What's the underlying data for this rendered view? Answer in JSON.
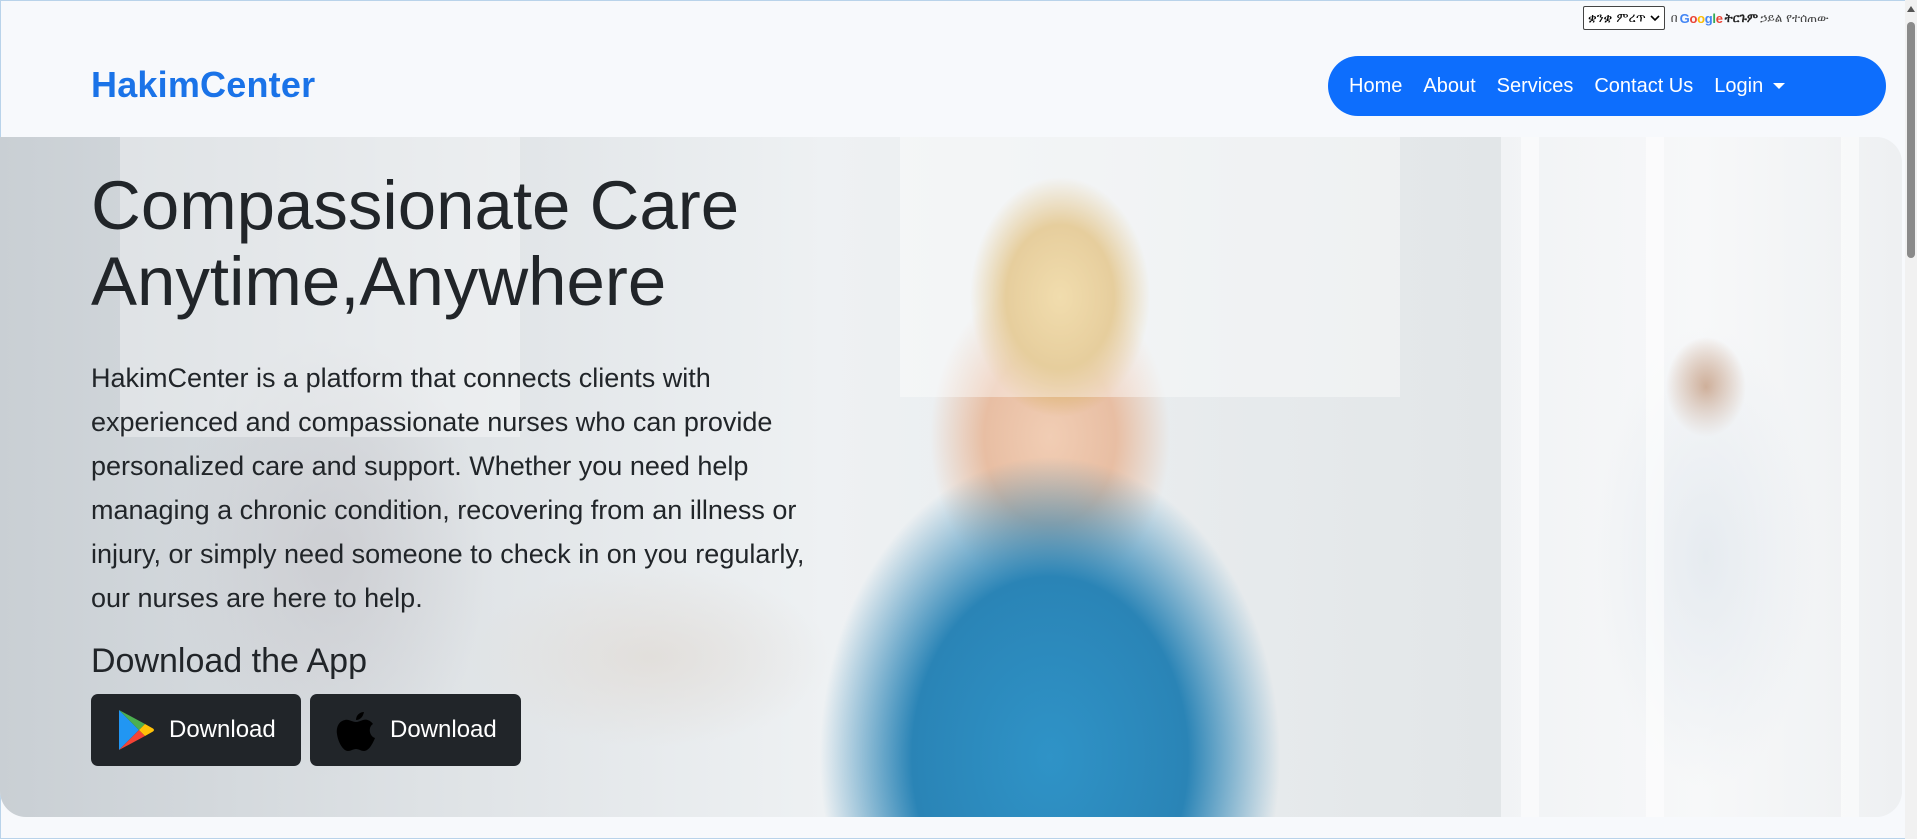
{
  "translate": {
    "language_select": "ቋንቋ ምረጥ",
    "powered_prefix": "በ",
    "google_letters": [
      "G",
      "o",
      "o",
      "g",
      "l",
      "e"
    ],
    "translate_word": "ትርጉም",
    "powered_suffix": "ኃይል የተሰጠው"
  },
  "header": {
    "brand": "HakimCenter",
    "nav": {
      "home": "Home",
      "about": "About",
      "services": "Services",
      "contact": "Contact Us",
      "login": "Login"
    },
    "nav_color": "#0d6efd",
    "brand_color": "#1a73e8"
  },
  "hero": {
    "title_line1": "Compassionate Care",
    "title_line2": "Anytime,Anywhere",
    "description": "HakimCenter is a platform that connects clients with experienced and compassionate nurses who can provide personalized care and support. Whether you need help managing a chronic condition, recovering from an illness or injury, or simply need someone to check in on you regularly, our nurses are here to help.",
    "download_heading": "Download the App",
    "buttons": {
      "google_play": {
        "label": "Download",
        "icon": "google-play-icon"
      },
      "app_store": {
        "label": "Download",
        "icon": "apple-icon"
      }
    }
  }
}
